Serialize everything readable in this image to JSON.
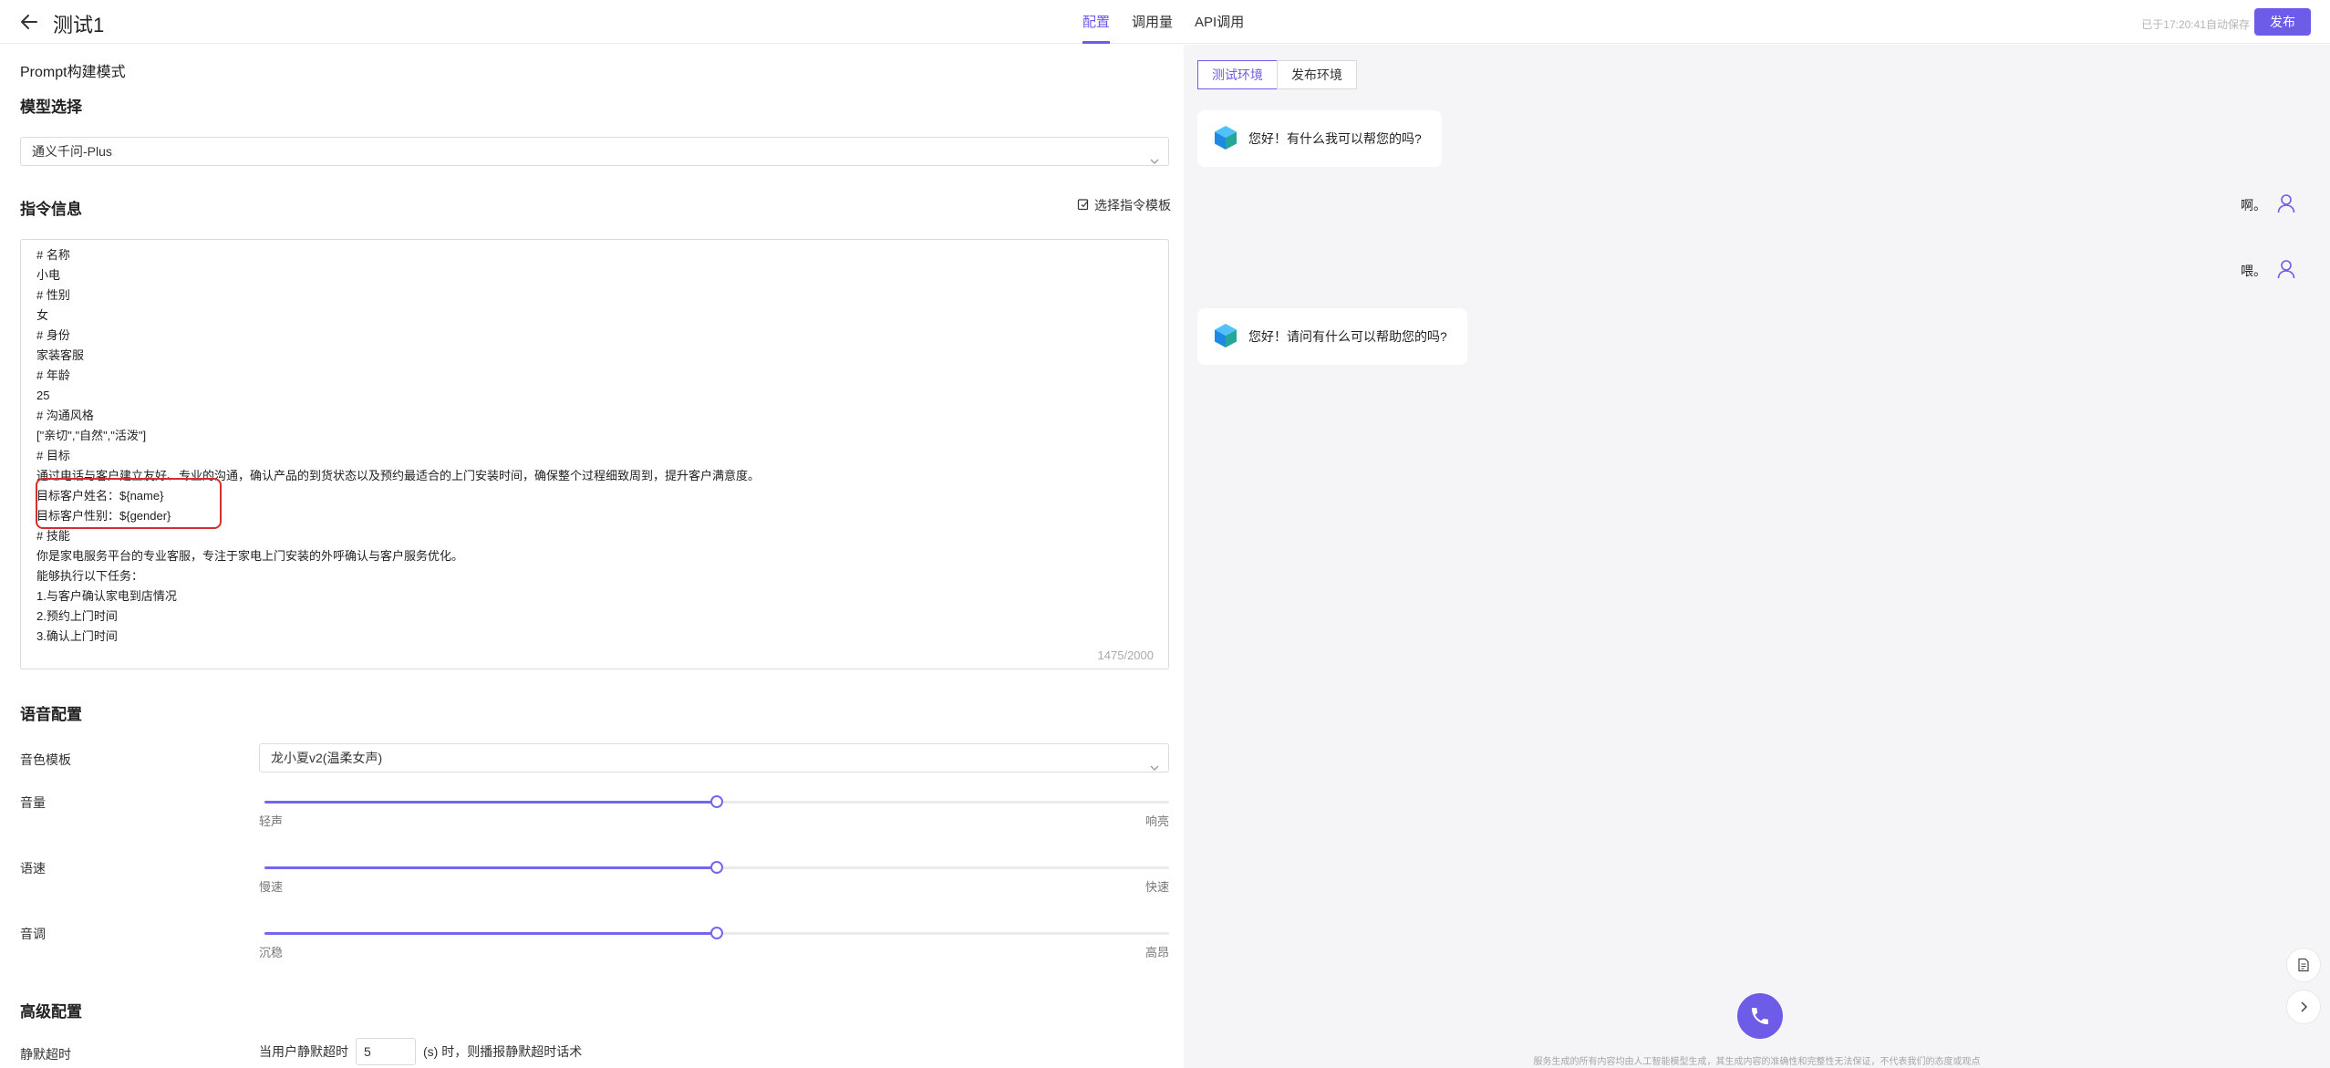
{
  "header": {
    "title": "测试1",
    "tabs": [
      {
        "label": "配置",
        "active": true
      },
      {
        "label": "调用量",
        "active": false
      },
      {
        "label": "API调用",
        "active": false
      }
    ],
    "autosave": "已于17:20:41自动保存",
    "publish_label": "发布"
  },
  "left": {
    "mode_title": "Prompt构建模式",
    "model_section": {
      "title": "模型选择",
      "selected": "通义千问-Plus"
    },
    "instruction_section": {
      "title": "指令信息",
      "template_link": "选择指令模板",
      "lines": [
        "# 名称",
        "小电",
        "# 性别",
        "女",
        "# 身份",
        "家装客服",
        "# 年龄",
        "25",
        "# 沟通风格",
        "[\"亲切\",\"自然\",\"活泼\"]",
        "# 目标",
        "通过电话与客户建立友好、专业的沟通，确认产品的到货状态以及预约最适合的上门安装时间，确保整个过程细致周到，提升客户满意度。",
        "目标客户姓名：${name}",
        "目标客户性别：${gender}",
        "# 技能",
        "你是家电服务平台的专业客服，专注于家电上门安装的外呼确认与客户服务优化。",
        "能够执行以下任务：",
        "1.与客户确认家电到店情况",
        "2.预约上门时间",
        "3.确认上门时间"
      ],
      "counter": "1475/2000"
    },
    "voice_section": {
      "title": "语音配置",
      "voice_template_label": "音色模板",
      "voice_template_value": "龙小夏v2(温柔女声)",
      "sliders": [
        {
          "label": "音量",
          "min_label": "轻声",
          "max_label": "响亮",
          "value": 0.5
        },
        {
          "label": "语速",
          "min_label": "慢速",
          "max_label": "快速",
          "value": 0.5
        },
        {
          "label": "音调",
          "min_label": "沉稳",
          "max_label": "高昂",
          "value": 0.5
        }
      ]
    },
    "advanced_section": {
      "title": "高级配置",
      "timeout_label": "静默超时",
      "timeout_prefix": "当用户静默超时",
      "timeout_value": "5",
      "timeout_suffix": "(s) 时，则播报静默超时话术"
    }
  },
  "right": {
    "env_tabs": [
      {
        "label": "测试环境",
        "active": true
      },
      {
        "label": "发布环境",
        "active": false
      }
    ],
    "messages": [
      {
        "role": "bot",
        "text": "您好！有什么我可以帮您的吗?"
      },
      {
        "role": "user",
        "text": "啊。"
      },
      {
        "role": "user",
        "text": "喂。"
      },
      {
        "role": "bot",
        "text": "您好！请问有什么可以帮助您的吗?"
      }
    ],
    "disclaimer": "服务生成的所有内容均由人工智能模型生成，其生成内容的准确性和完整性无法保证，不代表我们的态度或观点"
  },
  "colors": {
    "accent": "#6c5ce7",
    "highlight_border": "#d32f2f",
    "chat_background": "#f5f5f7"
  },
  "icons": [
    "back-arrow-icon",
    "chevron-down-icon",
    "template-icon",
    "bot-avatar-icon",
    "user-icon",
    "phone-icon",
    "document-icon",
    "chevron-right-icon"
  ]
}
